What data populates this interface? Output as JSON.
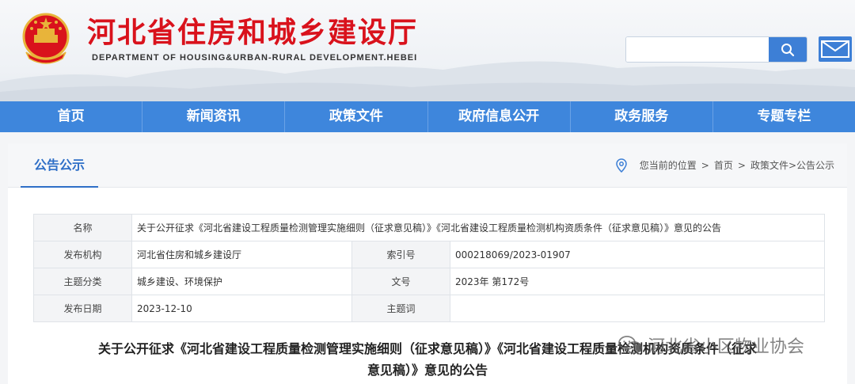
{
  "header": {
    "title": "河北省住房和城乡建设厅",
    "subtitle": "DEPARTMENT OF HOUSING&URBAN-RURAL DEVELOPMENT.HEBEI",
    "search_placeholder": "",
    "colors": {
      "title": "#d9121c",
      "nav": "#3e86dc",
      "accent": "#2f6fc7"
    }
  },
  "nav": {
    "items": [
      "首页",
      "新闻资讯",
      "政策文件",
      "政府信息公开",
      "政务服务",
      "专题专栏"
    ]
  },
  "section": {
    "tab_title": "公告公示",
    "breadcrumb": {
      "prefix": "您当前的位置",
      "home": "首页",
      "path": "政策文件>公告公示"
    }
  },
  "meta": {
    "name_label": "名称",
    "name_value": "关于公开征求《河北省建设工程质量检测管理实施细则（征求意见稿）》《河北省建设工程质量检测机构资质条件（征求意见稿）》意见的公告",
    "publisher_label": "发布机构",
    "publisher_value": "河北省住房和城乡建设厅",
    "index_label": "索引号",
    "index_value": "000218069/2023-01907",
    "category_label": "主题分类",
    "category_value": "城乡建设、环境保护",
    "doc_no_label": "文号",
    "doc_no_value": "2023年 第172号",
    "date_label": "发布日期",
    "date_value": "2023-12-10",
    "keywords_label": "主题词",
    "keywords_value": ""
  },
  "article": {
    "title_line1": "关于公开征求《河北省建设工程质量检测管理实施细则（征求意见稿）》《河北省建设工程质量检测机构资质条件（征求",
    "title_line2": "意见稿）》意见的公告"
  },
  "watermark": {
    "text": "河北省小区物业协会"
  }
}
